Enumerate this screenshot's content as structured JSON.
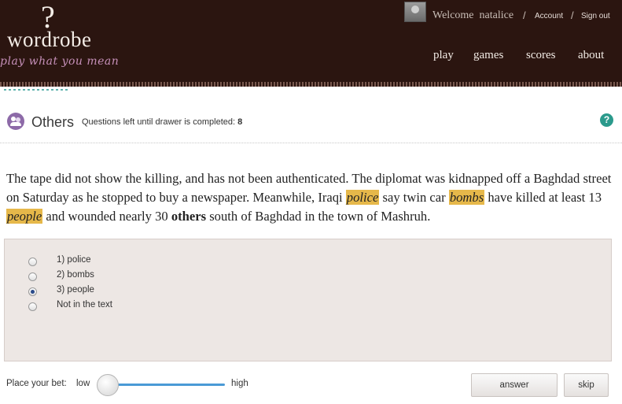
{
  "header": {
    "logo_mark": "?",
    "logo_name": "wordrobe",
    "tagline": "play what you mean",
    "welcome": "Welcome",
    "username": "natalice",
    "separator": "/",
    "account": "Account",
    "sign_out": "Sign out",
    "nav": [
      "play",
      "games",
      "scores",
      "about"
    ]
  },
  "game": {
    "title": "Others",
    "progress_label": "Questions left until drawer is completed:",
    "progress_count": "8",
    "help": "?"
  },
  "passage": {
    "p1": "The tape did not show the killing, and has not been authenticated. The diplomat was kidnapped off a Baghdad street on Saturday as he stopped to buy a newspaper. Meanwhile, Iraqi ",
    "h1": "police",
    "p2": " say twin car ",
    "h2": "bombs",
    "p3": " have killed at least 13 ",
    "h3": "people",
    "p4": " and wounded nearly 30 ",
    "target": "others",
    "p5": " south of Baghdad in the town of Mashruh."
  },
  "options": [
    {
      "label": "1) police",
      "checked": false
    },
    {
      "label": "2) bombs",
      "checked": false
    },
    {
      "label": "3) people",
      "checked": true
    },
    {
      "label": "Not in the text",
      "checked": false
    }
  ],
  "bet": {
    "label": "Place your bet:",
    "low": "low",
    "high": "high",
    "level": 0
  },
  "buttons": {
    "answer": "answer",
    "skip": "skip"
  },
  "colors": {
    "header_bg": "#2b1510",
    "highlight": "#e6b84a",
    "accent_purple": "#8d6aa8",
    "help_teal": "#2b9a8c",
    "slider_blue": "#4a9ad6"
  }
}
